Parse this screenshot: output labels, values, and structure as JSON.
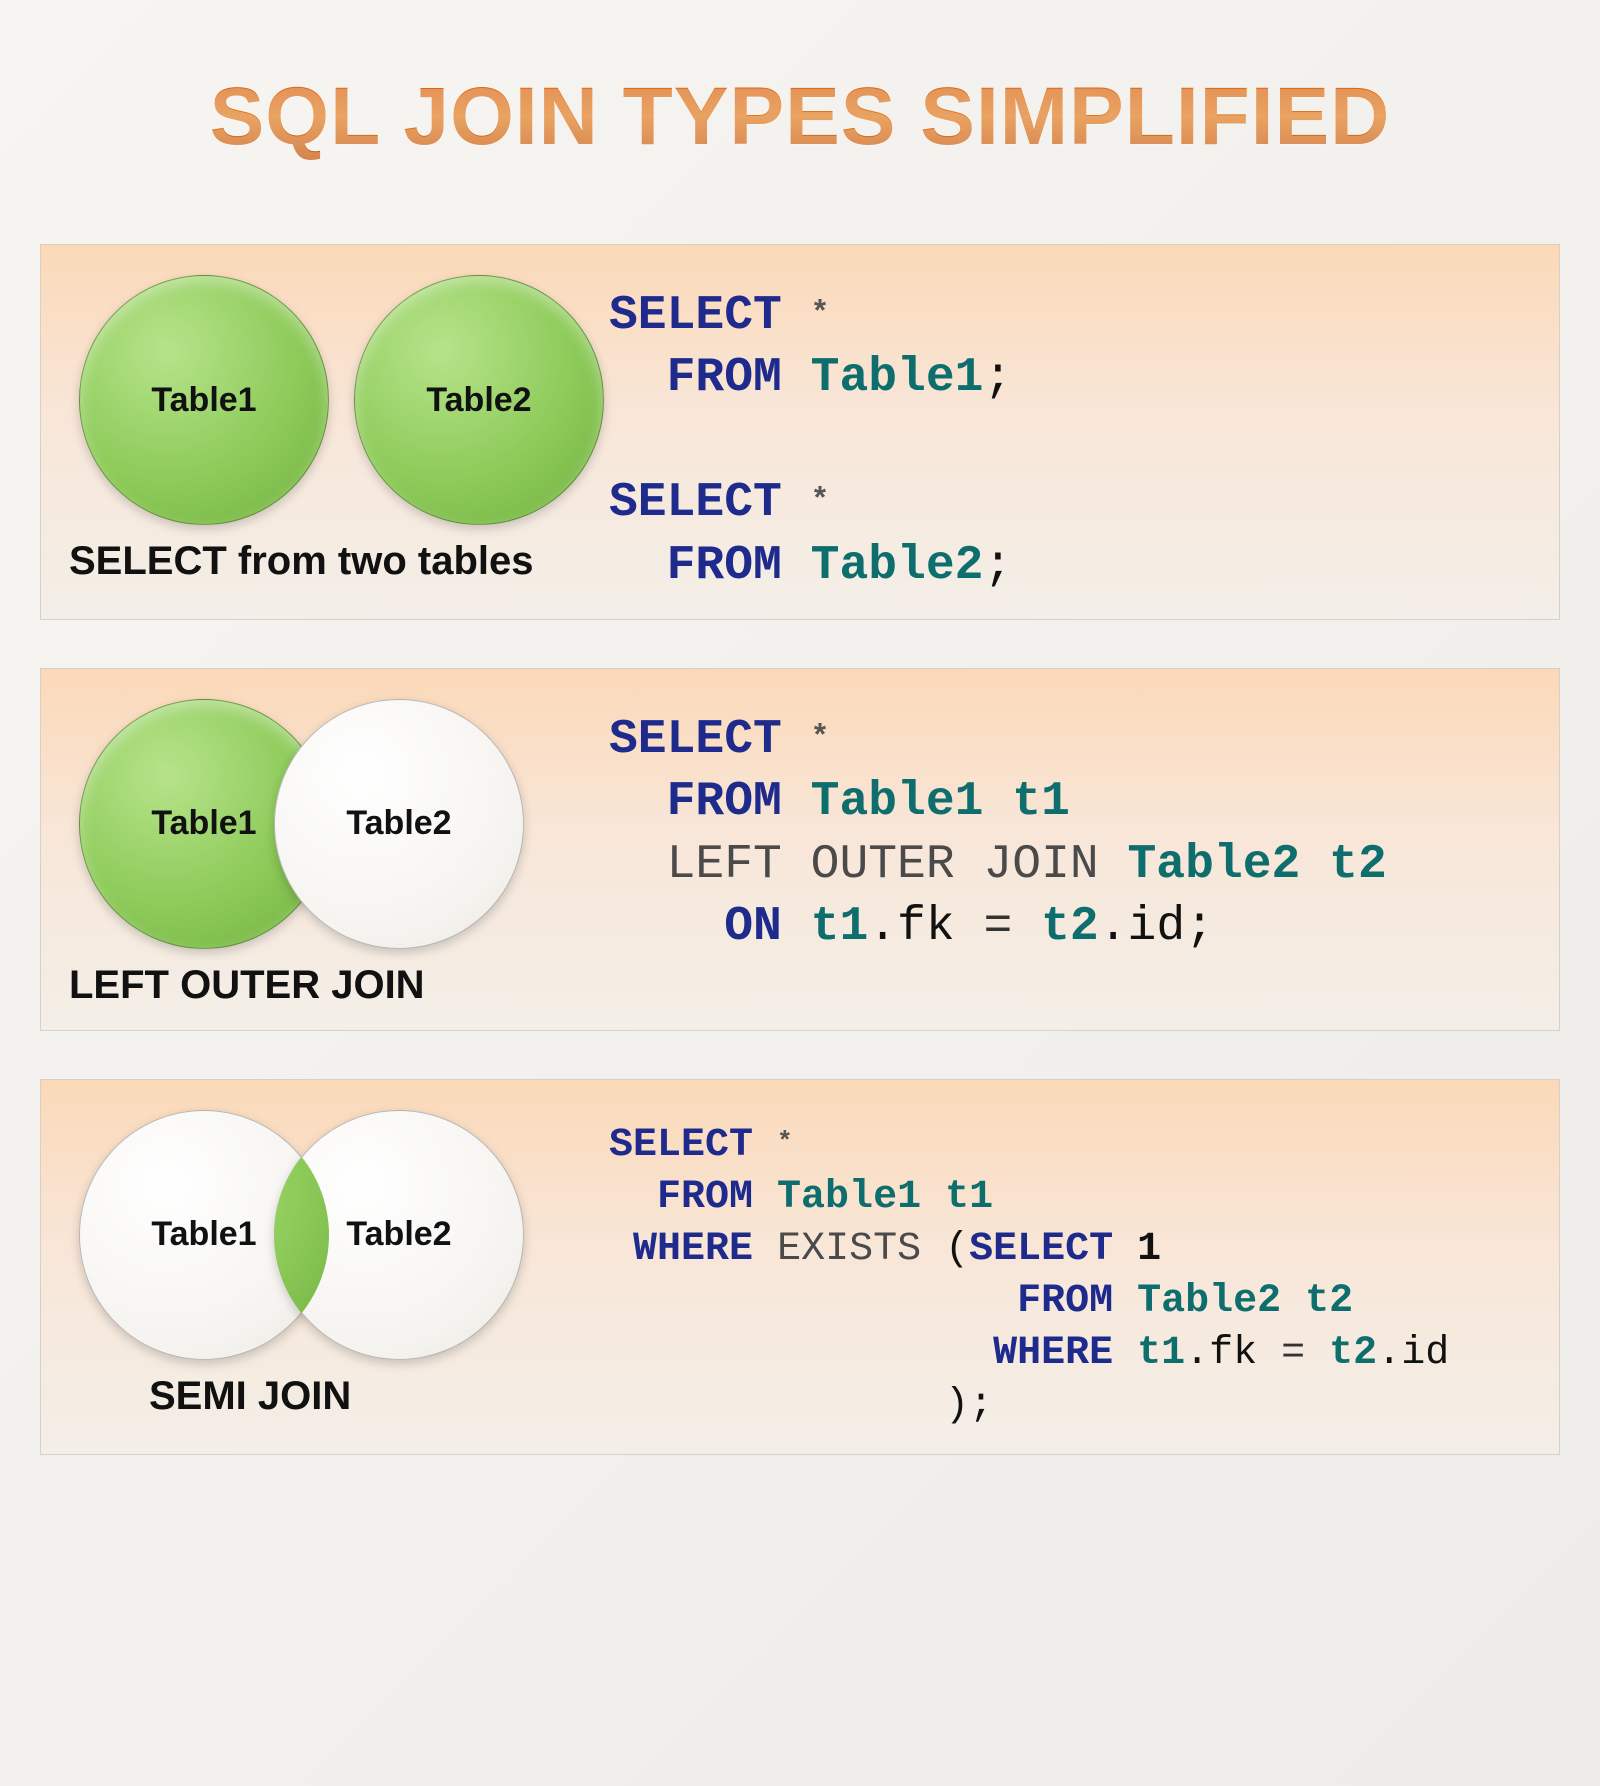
{
  "title": "SQL JOIN TYPES SIMPLIFIED",
  "panels": [
    {
      "label": "SELECT from two tables",
      "circle1": "Table1",
      "circle2": "Table2",
      "code_html": "<span class='kw'>SELECT</span> <span class='star'>*</span>\n  <span class='kw'>FROM</span> <span class='tbl'>Table1</span>;\n\n<span class='kw'>SELECT</span> <span class='star'>*</span>\n  <span class='kw'>FROM</span> <span class='tbl'>Table2</span>;"
    },
    {
      "label": "LEFT OUTER JOIN",
      "circle1": "Table1",
      "circle2": "Table2",
      "code_html": "<span class='kw'>SELECT</span> <span class='star'>*</span>\n  <span class='kw'>FROM</span> <span class='tbl'>Table1</span> <span class='tbl'>t1</span>\n  <span class='fn'>LEFT OUTER JOIN</span> <span class='tbl'>Table2</span> <span class='tbl'>t2</span>\n    <span class='kw'>ON</span> <span class='tbl'>t1</span>.fk <span class='op'>=</span> <span class='tbl'>t2</span>.id;"
    },
    {
      "label": "SEMI JOIN",
      "circle1": "Table1",
      "circle2": "Table2",
      "code_html": "<span class='kw'>SELECT</span> <span class='star'>*</span>\n  <span class='kw'>FROM</span> <span class='tbl'>Table1</span> <span class='tbl'>t1</span>\n <span class='kw'>WHERE</span> <span class='fn'>EXISTS</span> (<span class='kw'>SELECT</span> <span class='num'>1</span>\n                 <span class='kw'>FROM</span> <span class='tbl'>Table2</span> <span class='tbl'>t2</span>\n                <span class='kw'>WHERE</span> <span class='tbl'>t1</span>.fk <span class='op'>=</span> <span class='tbl'>t2</span>.id\n              );"
    }
  ]
}
